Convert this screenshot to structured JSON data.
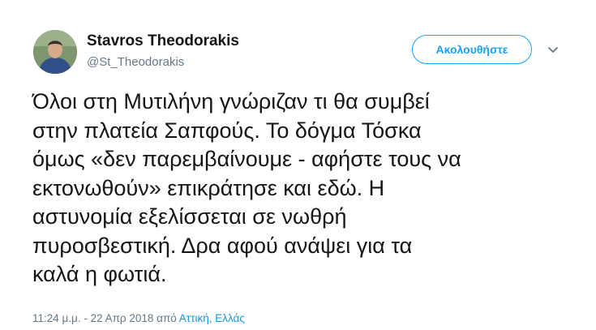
{
  "author": {
    "name": "Stavros Theodorakis",
    "handle": "@St_Theodorakis"
  },
  "follow_button": {
    "label": "Ακολουθήστε"
  },
  "menu": {
    "icon": "chevron-down-icon"
  },
  "tweet": {
    "text": "Όλοι στη Μυτιλήνη γνώριζαν τι θα συμβεί\nστην πλατεία Σαπφούς. Το δόγμα Τόσκα\nόμως «δεν παρεμβαίνουμε - αφήστε τους να\nεκτονωθούν» επικράτησε και εδώ. Η\nαστυνομία εξελίσσεται σε νωθρή\nπυροσβεστική. Δρα αφού ανάψει για τα\nκαλά η φωτιά."
  },
  "meta": {
    "timestamp": "11:24 μ.μ. - 22 Απρ 2018 από ",
    "location": "Αττική, Ελλάς"
  },
  "colors": {
    "accent": "#1da1f2",
    "link": "#1b95e0",
    "secondary_text": "#657786",
    "primary_text": "#14171a"
  }
}
